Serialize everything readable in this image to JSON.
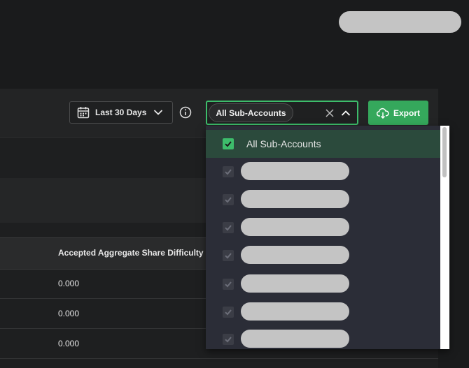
{
  "toolbar": {
    "date_range_label": "Last 30 Days",
    "export_label": "Export"
  },
  "filter": {
    "selected_chip": "All Sub-Accounts"
  },
  "table": {
    "columns": [
      "Accepted Aggregate Share Difficulty"
    ],
    "rows": [
      {
        "accepted_aggregate_share_difficulty": "0.000"
      },
      {
        "accepted_aggregate_share_difficulty": "0.000"
      },
      {
        "accepted_aggregate_share_difficulty": "0.000"
      }
    ]
  },
  "dropdown": {
    "options": [
      {
        "label": "All Sub-Accounts",
        "checked": true
      },
      {
        "label": "",
        "checked": false,
        "redacted": true
      },
      {
        "label": "",
        "checked": false,
        "redacted": true
      },
      {
        "label": "",
        "checked": false,
        "redacted": true
      },
      {
        "label": "",
        "checked": false,
        "redacted": true
      },
      {
        "label": "",
        "checked": false,
        "redacted": true
      },
      {
        "label": "",
        "checked": false,
        "redacted": true
      },
      {
        "label": "",
        "checked": false,
        "redacted": true
      }
    ]
  },
  "colors": {
    "accent": "#35a85c",
    "focus_border": "#3dbd6b",
    "dropdown_bg": "#2b2d37",
    "selected_row_bg": "#2b4a3c",
    "redaction": "#c4c4c4"
  },
  "icons": {
    "calendar": "calendar-icon",
    "chevron": "chevron-down-icon",
    "info": "info-icon",
    "clear": "close-icon",
    "caret": "chevron-up-icon",
    "export": "cloud-download-icon",
    "check": "checkmark-icon"
  }
}
